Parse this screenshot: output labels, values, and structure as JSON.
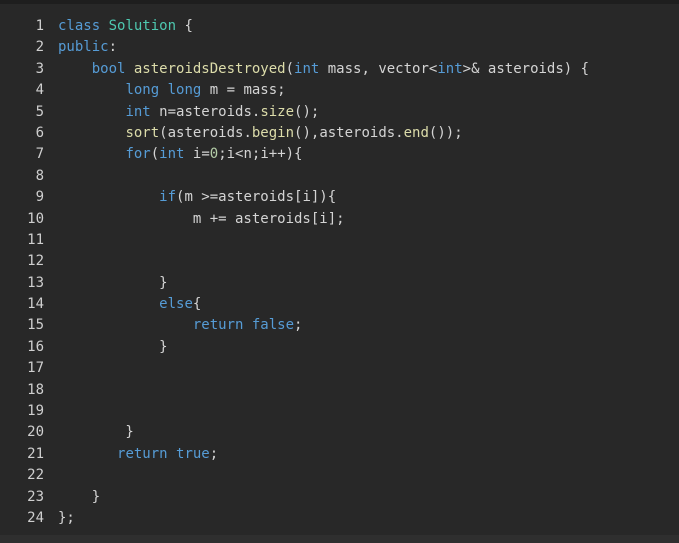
{
  "editor": {
    "lines": [
      {
        "n": "1",
        "t": [
          {
            "c": "class ",
            "k": "kw"
          },
          {
            "c": "Solution",
            "k": "cls"
          },
          {
            "c": " {",
            "k": ""
          }
        ]
      },
      {
        "n": "2",
        "t": [
          {
            "c": "public",
            "k": "kw"
          },
          {
            "c": ":",
            "k": ""
          }
        ]
      },
      {
        "n": "3",
        "t": [
          {
            "c": "    ",
            "k": ""
          },
          {
            "c": "bool ",
            "k": "kw"
          },
          {
            "c": "asteroidsDestroyed",
            "k": "fn"
          },
          {
            "c": "(",
            "k": ""
          },
          {
            "c": "int",
            "k": "kw"
          },
          {
            "c": " mass, vector<",
            "k": ""
          },
          {
            "c": "int",
            "k": "kw"
          },
          {
            "c": ">& asteroids) {",
            "k": ""
          }
        ]
      },
      {
        "n": "4",
        "t": [
          {
            "c": "        ",
            "k": ""
          },
          {
            "c": "long long",
            "k": "kw"
          },
          {
            "c": " m = mass;",
            "k": ""
          }
        ]
      },
      {
        "n": "5",
        "t": [
          {
            "c": "        ",
            "k": ""
          },
          {
            "c": "int",
            "k": "kw"
          },
          {
            "c": " n=asteroids.",
            "k": ""
          },
          {
            "c": "size",
            "k": "fn"
          },
          {
            "c": "();",
            "k": ""
          }
        ]
      },
      {
        "n": "6",
        "t": [
          {
            "c": "        ",
            "k": ""
          },
          {
            "c": "sort",
            "k": "fn"
          },
          {
            "c": "(asteroids.",
            "k": ""
          },
          {
            "c": "begin",
            "k": "fn"
          },
          {
            "c": "(),asteroids.",
            "k": ""
          },
          {
            "c": "end",
            "k": "fn"
          },
          {
            "c": "());",
            "k": ""
          }
        ]
      },
      {
        "n": "7",
        "t": [
          {
            "c": "        ",
            "k": ""
          },
          {
            "c": "for",
            "k": "kw"
          },
          {
            "c": "(",
            "k": ""
          },
          {
            "c": "int",
            "k": "kw"
          },
          {
            "c": " i=",
            "k": ""
          },
          {
            "c": "0",
            "k": "num"
          },
          {
            "c": ";i<n;i++){",
            "k": ""
          }
        ]
      },
      {
        "n": "8",
        "t": []
      },
      {
        "n": "9",
        "t": [
          {
            "c": "            ",
            "k": ""
          },
          {
            "c": "if",
            "k": "kw"
          },
          {
            "c": "(m >=asteroids[i]){",
            "k": ""
          }
        ]
      },
      {
        "n": "10",
        "t": [
          {
            "c": "                m += asteroids[i];",
            "k": ""
          }
        ]
      },
      {
        "n": "11",
        "t": []
      },
      {
        "n": "12",
        "t": []
      },
      {
        "n": "13",
        "t": [
          {
            "c": "            }",
            "k": ""
          }
        ]
      },
      {
        "n": "14",
        "t": [
          {
            "c": "            ",
            "k": ""
          },
          {
            "c": "else",
            "k": "kw"
          },
          {
            "c": "{",
            "k": ""
          }
        ]
      },
      {
        "n": "15",
        "t": [
          {
            "c": "                ",
            "k": ""
          },
          {
            "c": "return false",
            "k": "kw"
          },
          {
            "c": ";",
            "k": ""
          }
        ]
      },
      {
        "n": "16",
        "t": [
          {
            "c": "            }",
            "k": ""
          }
        ]
      },
      {
        "n": "17",
        "t": []
      },
      {
        "n": "18",
        "t": []
      },
      {
        "n": "19",
        "t": []
      },
      {
        "n": "20",
        "t": [
          {
            "c": "        }",
            "k": ""
          }
        ]
      },
      {
        "n": "21",
        "t": [
          {
            "c": "       ",
            "k": ""
          },
          {
            "c": "return true",
            "k": "kw"
          },
          {
            "c": ";",
            "k": ""
          }
        ]
      },
      {
        "n": "22",
        "t": []
      },
      {
        "n": "23",
        "t": [
          {
            "c": "    }",
            "k": ""
          }
        ]
      },
      {
        "n": "24",
        "t": [
          {
            "c": "};",
            "k": ""
          }
        ]
      }
    ]
  },
  "colors": {
    "background": "#282828",
    "keyword": "#569cd6",
    "class": "#4ec9b0",
    "function": "#dcdcaa",
    "number": "#b5cea8",
    "text": "#d4d4d4",
    "line_number": "#cfcfcf"
  }
}
